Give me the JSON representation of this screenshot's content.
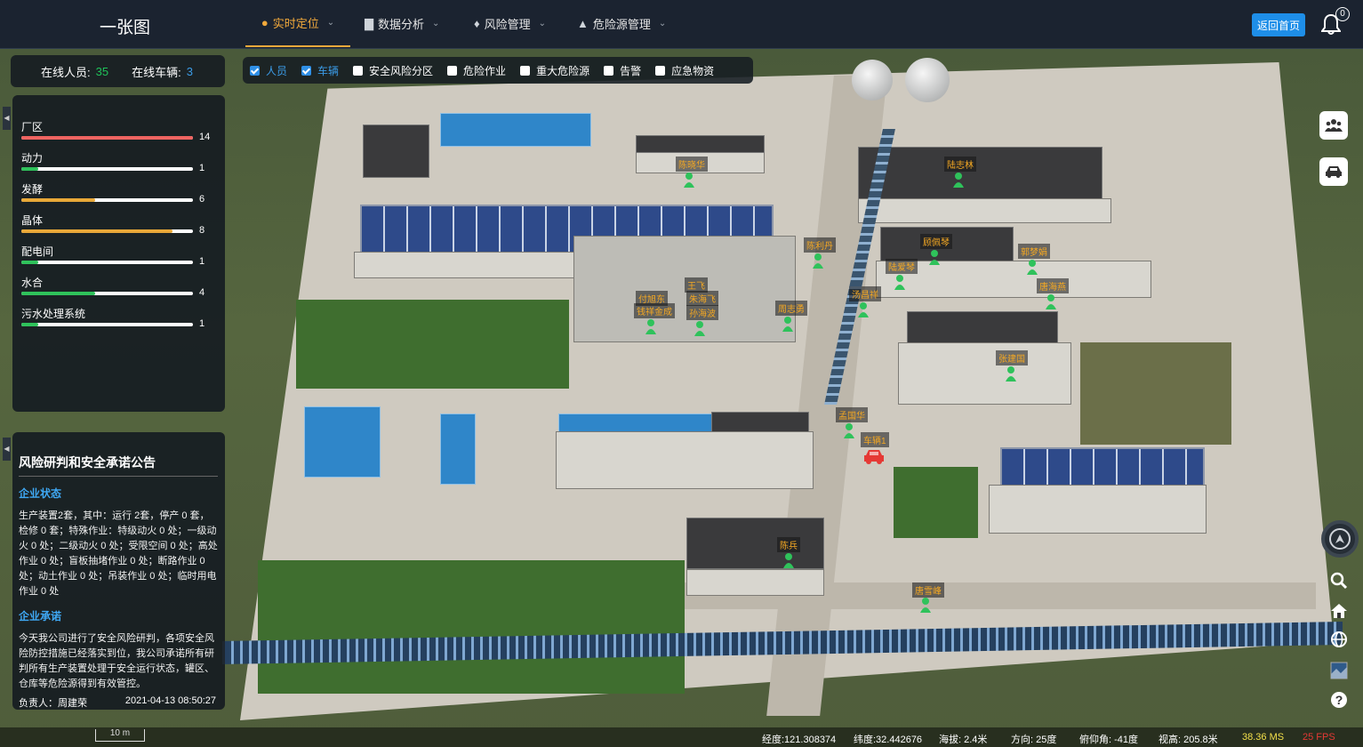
{
  "app": {
    "title": "一张图"
  },
  "nav": [
    {
      "label": "实时定位",
      "icon": "location-pin-icon",
      "active": true
    },
    {
      "label": "数据分析",
      "icon": "bar-chart-icon",
      "active": false
    },
    {
      "label": "风险管理",
      "icon": "flame-icon",
      "active": false
    },
    {
      "label": "危险源管理",
      "icon": "warning-icon",
      "active": false
    }
  ],
  "header": {
    "home_button": "返回首页",
    "notification_count": "0"
  },
  "stats": {
    "online_staff_label": "在线人员:",
    "online_staff": "35",
    "online_vehicles_label": "在线车辆:",
    "online_vehicles": "3"
  },
  "zones": [
    {
      "name": "厂区",
      "count": "14",
      "level": 1.0,
      "color": "#f06461"
    },
    {
      "name": "动力",
      "count": "1",
      "level": 0.1,
      "color": "#2fc25b"
    },
    {
      "name": "发酵",
      "count": "6",
      "level": 0.43,
      "color": "#e8a838"
    },
    {
      "name": "晶体",
      "count": "8",
      "level": 0.88,
      "color": "#e8a838"
    },
    {
      "name": "配电间",
      "count": "1",
      "level": 0.1,
      "color": "#2fc25b"
    },
    {
      "name": "水合",
      "count": "4",
      "level": 0.43,
      "color": "#2fc25b"
    },
    {
      "name": "污水处理系统",
      "count": "1",
      "level": 0.1,
      "color": "#2fc25b"
    }
  ],
  "notice": {
    "title": "风险研判和安全承诺公告",
    "status_heading": "企业状态",
    "status_text": "生产装置2套，其中：运行 2套，停产 0 套，检修 0 套；特殊作业：特级动火 0 处；一级动火 0 处；二级动火 0 处；受限空间 0 处；高处作业 0 处；盲板抽堵作业 0 处；断路作业 0 处；动土作业 0 处；吊装作业 0 处；临时用电作业 0 处",
    "commit_heading": "企业承诺",
    "commit_text": "今天我公司进行了安全风险研判，各项安全风险防控措施已经落实到位，我公司承诺所有研判所有生产装置处理于安全运行状态，罐区、仓库等危险源得到有效管控。",
    "responsible": "负责人：周建荣",
    "date": "2021-04-13 08:50:27"
  },
  "layers": [
    {
      "label": "人员",
      "checked": true
    },
    {
      "label": "车辆",
      "checked": true
    },
    {
      "label": "安全风险分区",
      "checked": false
    },
    {
      "label": "危险作业",
      "checked": false
    },
    {
      "label": "重大危险源",
      "checked": false
    },
    {
      "label": "告警",
      "checked": false
    },
    {
      "label": "应急物资",
      "checked": false
    }
  ],
  "markers": [
    {
      "name": "陈晓华"
    },
    {
      "name": "陆志林"
    },
    {
      "name": "陈利丹"
    },
    {
      "name": "顾佩琴"
    },
    {
      "name": "郭梦娟"
    },
    {
      "name": "陆爱琴"
    },
    {
      "name": "唐海燕"
    },
    {
      "name": "汤昌祥"
    },
    {
      "name": "王飞"
    },
    {
      "name": "朱海飞"
    },
    {
      "name": "孙海波"
    },
    {
      "name": "付旭东"
    },
    {
      "name": "钱祥金成"
    },
    {
      "name": "周志勇"
    },
    {
      "name": "孟国华"
    },
    {
      "name": "陈兵"
    },
    {
      "name": "唐雪峰"
    },
    {
      "name": "张建国"
    }
  ],
  "vehicle": {
    "name": "车辆1"
  },
  "status": {
    "scale": "10 m",
    "lon": "经度:121.308374",
    "lat": "纬度:32.442676",
    "alt": "海拔: 2.4米",
    "heading": "方向: 25度",
    "pitch": "俯仰角: -41度",
    "height": "视高: 205.8米",
    "ms": "38.36 MS",
    "fps": "25 FPS"
  },
  "colors": {
    "accent": "#f2a93b",
    "primary": "#1e8ee8",
    "person": "#2fc25b",
    "vehicle": "#e53935"
  }
}
